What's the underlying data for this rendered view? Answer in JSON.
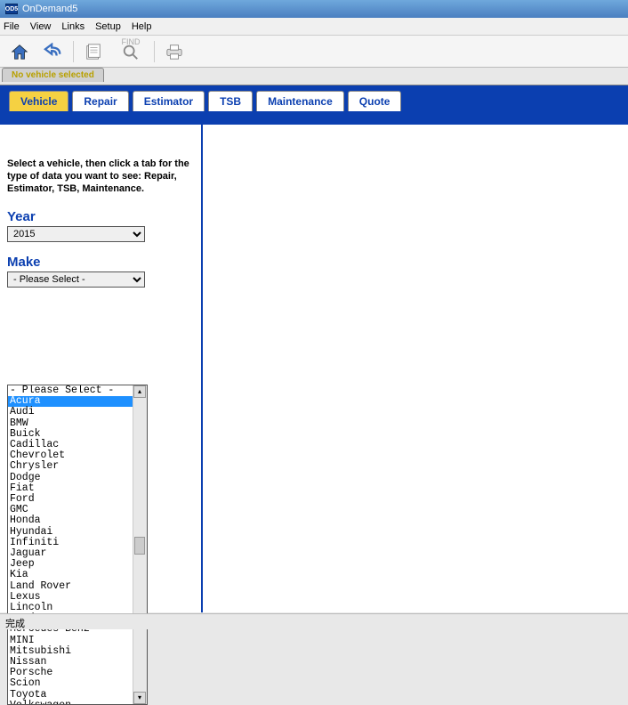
{
  "window": {
    "icon_text": "OD5",
    "title": "OnDemand5"
  },
  "menu": [
    "File",
    "View",
    "Links",
    "Setup",
    "Help"
  ],
  "toolbar": {
    "find_label": "FIND"
  },
  "vehicle_status": {
    "label": "No vehicle selected"
  },
  "tabs": [
    {
      "label": "Vehicle",
      "active": true
    },
    {
      "label": "Repair",
      "active": false
    },
    {
      "label": "Estimator",
      "active": false
    },
    {
      "label": "TSB",
      "active": false
    },
    {
      "label": "Maintenance",
      "active": false
    },
    {
      "label": "Quote",
      "active": false
    }
  ],
  "sidebar": {
    "intro": "Select a vehicle, then click a tab for the type of data you want to see: Repair, Estimator, TSB, Maintenance.",
    "year_label": "Year",
    "year_value": "2015",
    "make_label": "Make",
    "make_value": "- Please Select -",
    "make_options": [
      "- Please Select -",
      "Acura",
      "Audi",
      "BMW",
      "Buick",
      "Cadillac",
      "Chevrolet",
      "Chrysler",
      "Dodge",
      "Fiat",
      "Ford",
      "GMC",
      "Honda",
      "Hyundai",
      "Infiniti",
      "Jaguar",
      "Jeep",
      "Kia",
      "Land Rover",
      "Lexus",
      "Lincoln",
      "Mazda",
      "Mercedes-Benz",
      "MINI",
      "Mitsubishi",
      "Nissan",
      "Porsche",
      "Scion",
      "Toyota",
      "Volkswagen"
    ],
    "highlighted_index": 1
  },
  "status_bar": {
    "text": "完成"
  }
}
